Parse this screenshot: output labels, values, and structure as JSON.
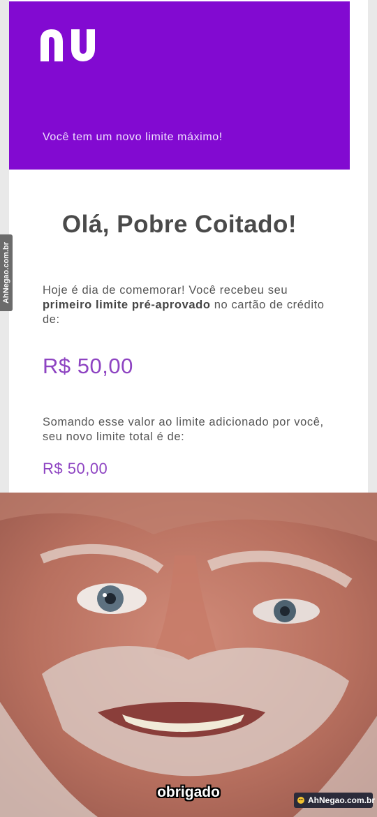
{
  "email": {
    "logo_text": "nu",
    "tagline": "Você tem um novo limite máximo!",
    "greeting": "Olá, Pobre Coitado!",
    "paragraph1_start": "Hoje é dia de comemorar! Você recebeu seu ",
    "paragraph1_bold": "primeiro limite pré-aprovado",
    "paragraph1_end": " no cartão de crédito de:",
    "amount1": "R$ 50,00",
    "paragraph2": "Somando esse valor ao limite adicionado por você, seu novo limite total é de:",
    "amount2": "R$ 50,00"
  },
  "meme": {
    "caption": "obrigado"
  },
  "watermark": {
    "side_text": "AhNegao.com.br",
    "bottom_text": "AhNegao.com.br"
  },
  "colors": {
    "brand_purple": "#820ad1",
    "amount_purple": "#8e44c2"
  }
}
